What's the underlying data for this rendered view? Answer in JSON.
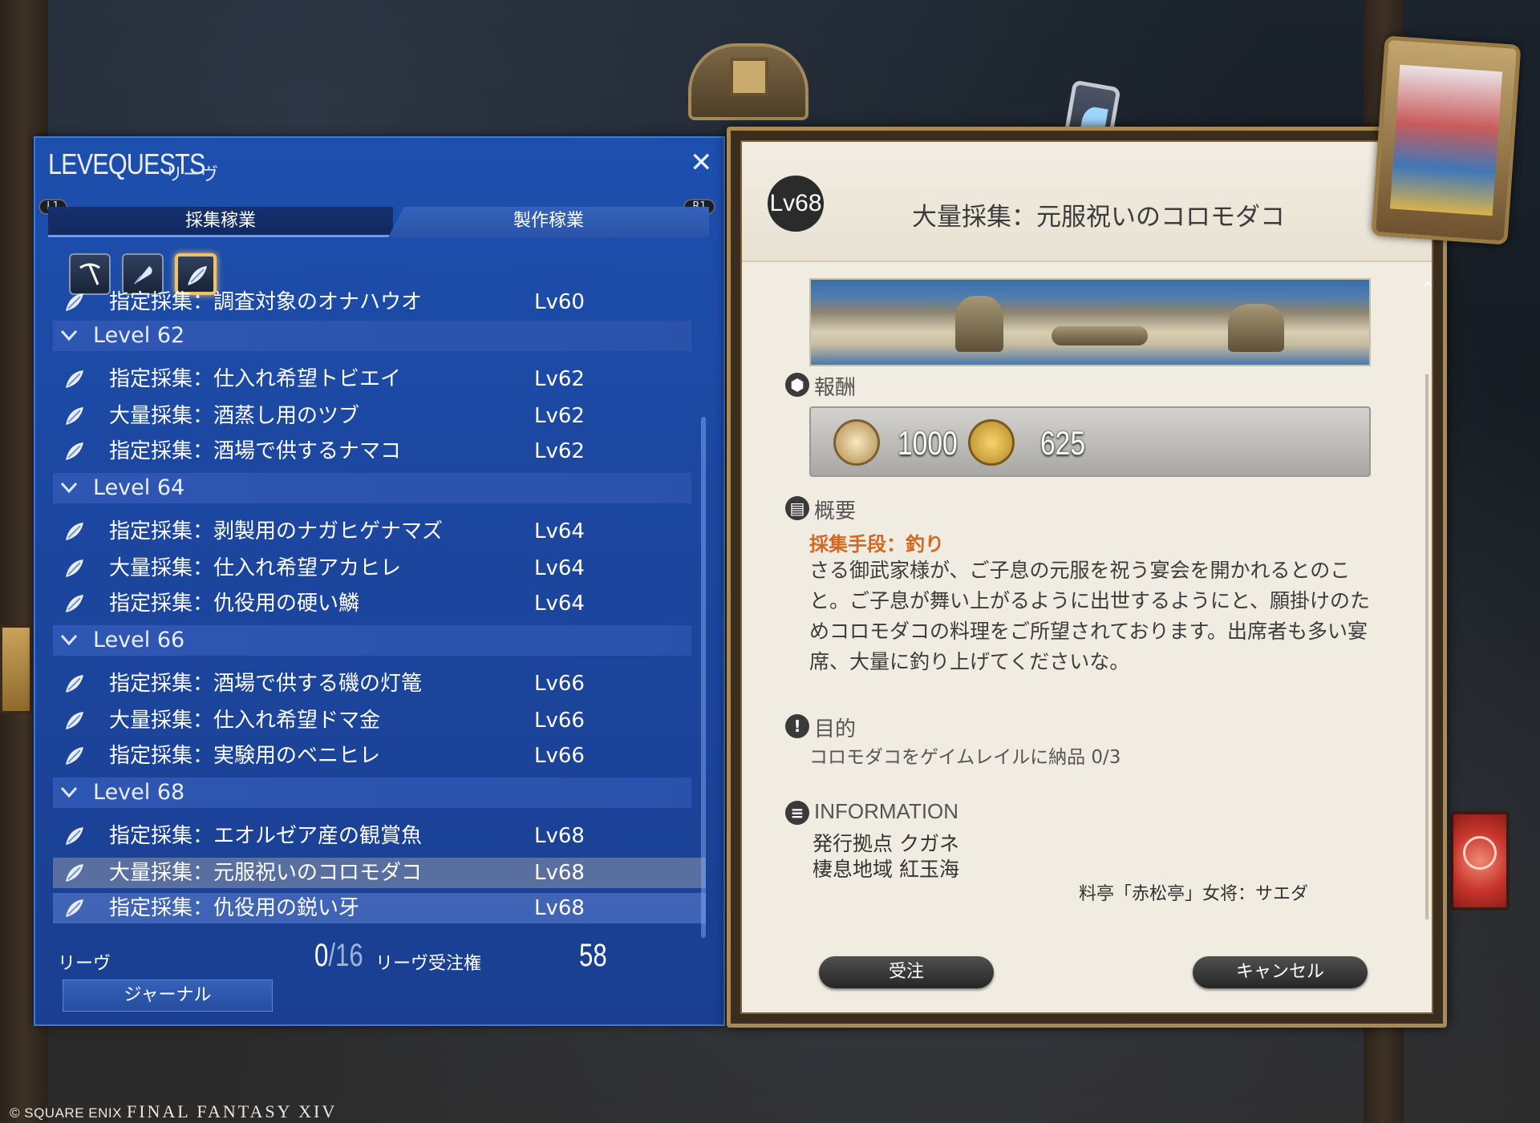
{
  "colors": {
    "panel_blue": "#1d4fae",
    "parchment": "#f1ece1",
    "method_orange": "#d46820",
    "gold_frame": "#a98a55"
  },
  "leve_panel": {
    "title": "LEVEQUESTS",
    "subtitle": "リーヴ",
    "close_icon": "close-icon",
    "l1": "L1",
    "r1": "R1",
    "tabs": [
      {
        "label": "採集稼業"
      },
      {
        "label": "製作稼業"
      }
    ],
    "class_icons": [
      "miner-pickaxe-icon",
      "botanist-hatchet-icon",
      "fisher-icon"
    ],
    "rows": [
      {
        "kind": "quest",
        "name": "指定採集：調査対象のオナハウオ",
        "level": "Lv60"
      },
      {
        "kind": "header",
        "name": "Level 62"
      },
      {
        "kind": "quest",
        "name": "指定採集：仕入れ希望トビエイ",
        "level": "Lv62"
      },
      {
        "kind": "quest",
        "name": "大量採集：酒蒸し用のツブ",
        "level": "Lv62"
      },
      {
        "kind": "quest",
        "name": "指定採集：酒場で供するナマコ",
        "level": "Lv62"
      },
      {
        "kind": "header",
        "name": "Level 64"
      },
      {
        "kind": "quest",
        "name": "指定採集：剥製用のナガヒゲナマズ",
        "level": "Lv64"
      },
      {
        "kind": "quest",
        "name": "大量採集：仕入れ希望アカヒレ",
        "level": "Lv64"
      },
      {
        "kind": "quest",
        "name": "指定採集：仇役用の硬い鱗",
        "level": "Lv64"
      },
      {
        "kind": "header",
        "name": "Level 66"
      },
      {
        "kind": "quest",
        "name": "指定採集：酒場で供する磯の灯篭",
        "level": "Lv66"
      },
      {
        "kind": "quest",
        "name": "大量採集：仕入れ希望ドマ金",
        "level": "Lv66"
      },
      {
        "kind": "quest",
        "name": "指定採集：実験用のベニヒレ",
        "level": "Lv66"
      },
      {
        "kind": "header",
        "name": "Level 68"
      },
      {
        "kind": "quest",
        "name": "指定採集：エオルゼア産の観賞魚",
        "level": "Lv68"
      },
      {
        "kind": "quest",
        "name": "大量採集：元服祝いのコロモダコ",
        "level": "Lv68",
        "selected": true
      },
      {
        "kind": "quest",
        "name": "指定採集：仇役用の鋭い牙",
        "level": "Lv68",
        "hover": true
      }
    ],
    "footer": {
      "leve_label": "リーヴ",
      "leve_count": "0",
      "leve_max": "16",
      "allowance_label": "リーヴ受注権",
      "allowance": "58",
      "journal_button": "ジャーナル"
    }
  },
  "detail": {
    "level": "Lv68",
    "title": "大量採集：元服祝いのコロモダコ",
    "reward_label": "報酬",
    "rewards": [
      {
        "icon": "seal-icon",
        "value": "1000"
      },
      {
        "icon": "gil-icon",
        "value": "625"
      }
    ],
    "overview_label": "概要",
    "method": "採集手段：釣り",
    "description": "さる御武家様が、ご子息の元服を祝う宴会を開かれるとのこと。ご子息が舞い上がるように出世するようにと、願掛けのためコロモダコの料理をご所望されております。出席者も多い宴席、大量に釣り上げてくださいな。",
    "objective_label": "目的",
    "objective": "コロモダコをゲイムレイルに納品 0/3",
    "info_label": "INFORMATION",
    "info_lines": [
      "発行拠点 クガネ",
      "棲息地域 紅玉海"
    ],
    "giver": "料亭「赤松亭」女将：サエダ",
    "accept_button": "受注",
    "cancel_button": "キャンセル"
  },
  "copyright": {
    "publisher": "© SQUARE ENIX",
    "game": "FINAL FANTASY XIV"
  }
}
